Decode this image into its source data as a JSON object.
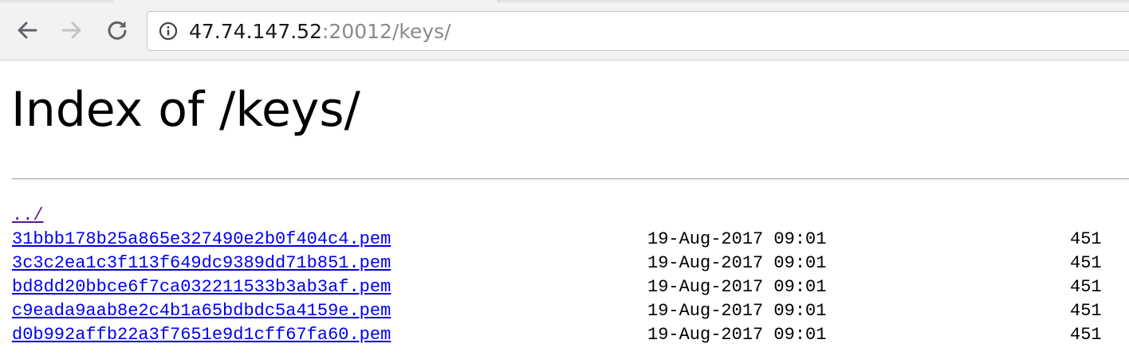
{
  "browser": {
    "url_host": "47.74.147.52",
    "url_rest": ":20012/keys/"
  },
  "page": {
    "title": "Index of /keys/",
    "parent_link": "../",
    "files": [
      {
        "name": "31bbb178b25a865e327490e2b0f404c4.pem",
        "date": "19-Aug-2017 09:01",
        "size": "451"
      },
      {
        "name": "3c3c2ea1c3f113f649dc9389dd71b851.pem",
        "date": "19-Aug-2017 09:01",
        "size": "451"
      },
      {
        "name": "bd8dd20bbce6f7ca032211533b3ab3af.pem",
        "date": "19-Aug-2017 09:01",
        "size": "451"
      },
      {
        "name": "c9eada9aab8e2c4b1a65bdbdc5a4159e.pem",
        "date": "19-Aug-2017 09:01",
        "size": "451"
      },
      {
        "name": "d0b992affb22a3f7651e9d1cff67fa60.pem",
        "date": "19-Aug-2017 09:01",
        "size": "451"
      }
    ]
  },
  "colors": {
    "link": "#0000ee",
    "visited_link": "#551a8b"
  }
}
